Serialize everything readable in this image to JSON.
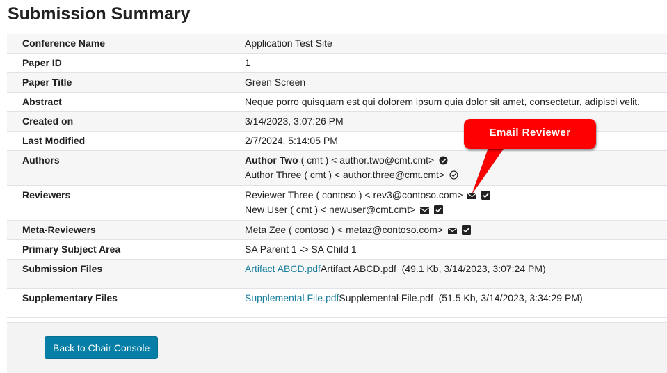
{
  "page": {
    "title": "Submission Summary"
  },
  "summary": {
    "conference_name": {
      "label": "Conference Name",
      "value": "Application Test Site"
    },
    "paper_id": {
      "label": "Paper ID",
      "value": "1"
    },
    "paper_title": {
      "label": "Paper Title",
      "value": "Green Screen"
    },
    "abstract": {
      "label": "Abstract",
      "value": "Neque porro quisquam est qui dolorem ipsum quia dolor sit amet, consectetur, adipisci velit."
    },
    "created_on": {
      "label": "Created on",
      "value": "3/14/2023, 3:07:26 PM"
    },
    "last_modified": {
      "label": "Last Modified",
      "value": "2/7/2024, 5:14:05 PM"
    },
    "authors": {
      "label": "Authors",
      "items": [
        {
          "name": "Author Two",
          "rest": " ( cmt ) < author.two@cmt.cmt>",
          "primary": true,
          "icon": "check-circle-filled-icon"
        },
        {
          "name": "Author Three",
          "rest": " ( cmt ) < author.three@cmt.cmt>",
          "primary": false,
          "icon": "check-circle-outline-icon"
        }
      ]
    },
    "reviewers": {
      "label": "Reviewers",
      "items": [
        {
          "text": "Reviewer Three ( contoso ) < rev3@contoso.com>"
        },
        {
          "text": "New User ( cmt ) < newuser@cmt.cmt>"
        }
      ]
    },
    "meta_reviewers": {
      "label": "Meta-Reviewers",
      "items": [
        {
          "text": "Meta Zee ( contoso ) < metaz@contoso.com>"
        }
      ]
    },
    "primary_subject_area": {
      "label": "Primary Subject Area",
      "value": "SA Parent 1 -> SA Child 1"
    },
    "submission_files": {
      "label": "Submission Files",
      "link": "Artifact ABCD.pdf",
      "name": "Artifact ABCD.pdf",
      "details": "  (49.1 Kb, 3/14/2023, 3:07:24 PM)"
    },
    "supplementary_files": {
      "label": "Supplementary Files",
      "link": "Supplemental File.pdf",
      "name": "Supplemental File.pdf",
      "details": "  (51.5 Kb, 3/14/2023, 3:34:29 PM)"
    }
  },
  "footer": {
    "back_button": "Back to Chair Console"
  },
  "callout": {
    "text": "Email Reviewer"
  },
  "colors": {
    "link": "#1a7f9c",
    "button": "#067ea5",
    "callout": "#ff0000"
  }
}
